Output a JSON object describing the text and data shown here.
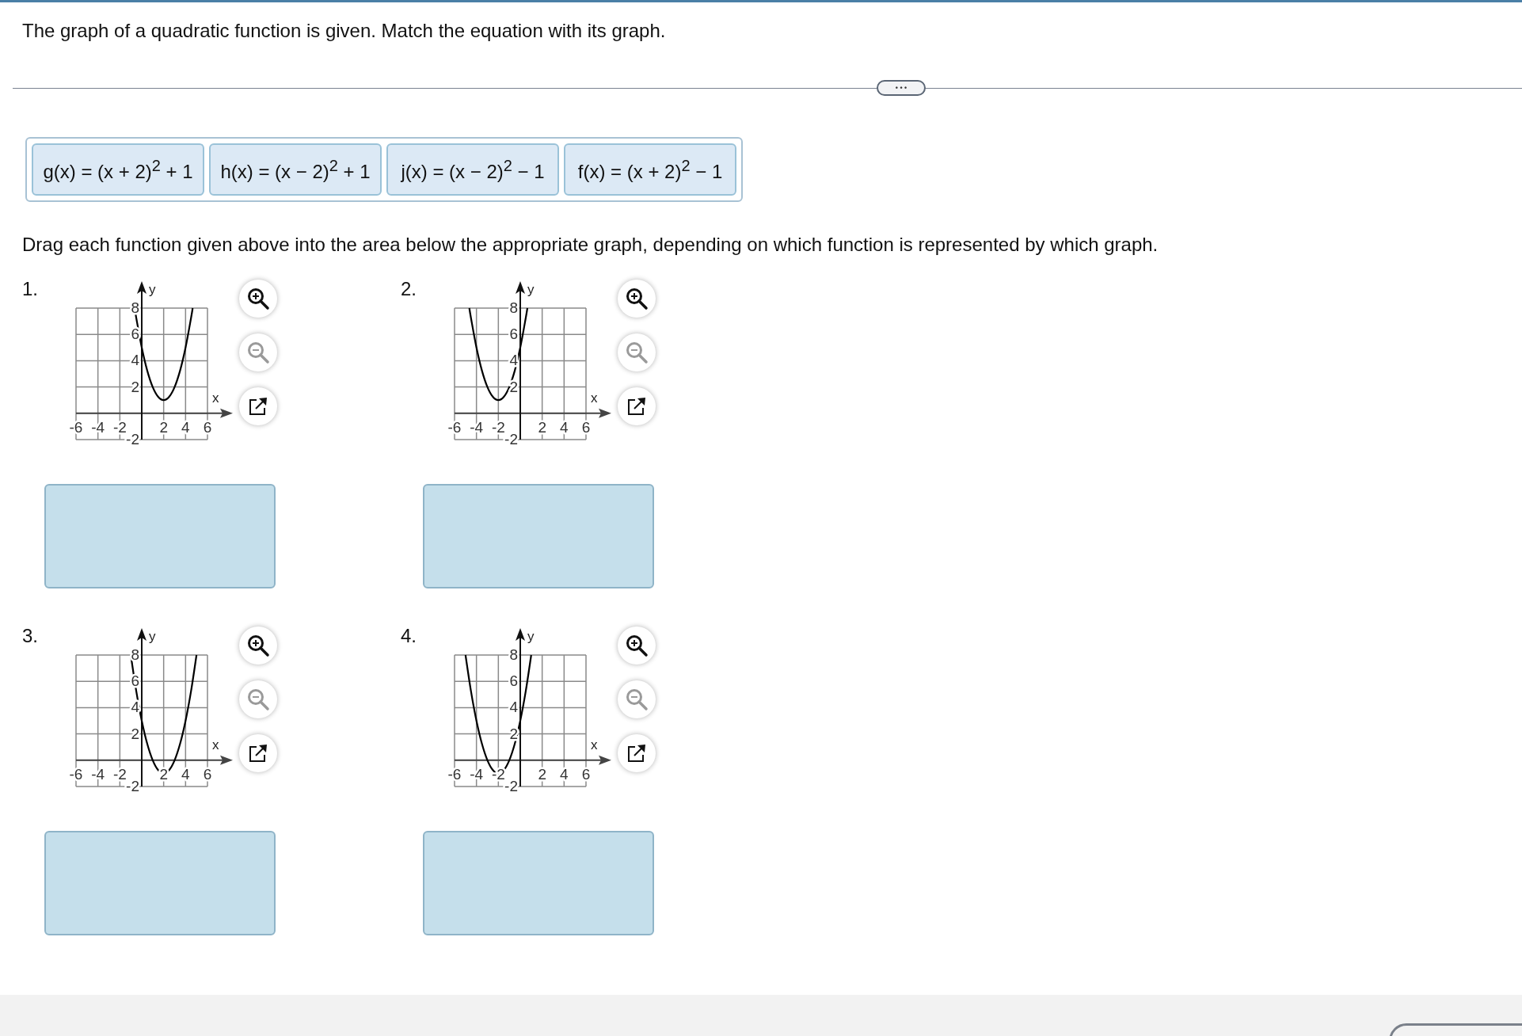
{
  "question": "The graph of a quadratic function is given. Match the equation with its graph.",
  "divider_button": "• • •",
  "choices": [
    "g(x) = (x + 2)$^{2}$ + 1",
    "h(x) = (x − 2)$^{2}$ + 1",
    "j(x) = (x − 2)$^{2}$ − 1",
    "f(x) = (x + 2)$^{2}$ − 1"
  ],
  "instruction": "Drag each function given above into the area below the appropriate graph, depending on which function is represented by which graph.",
  "graphs": [
    {
      "number": "1.",
      "zoom_out_disabled": true,
      "chart_data": {
        "type": "line",
        "xlabel": "x",
        "ylabel": "y",
        "xlim": [
          -6,
          6
        ],
        "ylim": [
          -2,
          8
        ],
        "xticks": [
          -6,
          -4,
          -2,
          2,
          4,
          6
        ],
        "yticks": [
          -2,
          2,
          4,
          6,
          8
        ],
        "x": [
          -0.65,
          -0.5,
          0,
          0.5,
          1,
          1.5,
          2,
          2.5,
          3,
          3.5,
          4,
          4.5,
          4.65
        ],
        "grid": true,
        "series": [
          {
            "color": "#000000",
            "values": [
              8,
              7.25,
              5,
              3.25,
              2,
              1.25,
              1,
              1.25,
              2,
              3.25,
              5,
              7.25,
              8
            ]
          }
        ]
      }
    },
    {
      "number": "2.",
      "zoom_out_disabled": true,
      "chart_data": {
        "type": "line",
        "xlabel": "x",
        "ylabel": "y",
        "xlim": [
          -6,
          6
        ],
        "ylim": [
          -2,
          8
        ],
        "xticks": [
          -6,
          -4,
          -2,
          2,
          4,
          6
        ],
        "yticks": [
          -2,
          2,
          4,
          6,
          8
        ],
        "x": [
          -4.65,
          -4.5,
          -4,
          -3.5,
          -3,
          -2.5,
          -2,
          -1.5,
          -1,
          -0.5,
          0,
          0.5,
          0.65
        ],
        "grid": true,
        "series": [
          {
            "color": "#000000",
            "values": [
              8,
              7.25,
              5,
              3.25,
              2,
              1.25,
              1,
              1.25,
              2,
              3.25,
              5,
              7.25,
              8
            ]
          }
        ]
      }
    },
    {
      "number": "3.",
      "zoom_out_disabled": true,
      "chart_data": {
        "type": "line",
        "xlabel": "x",
        "ylabel": "y",
        "xlim": [
          -6,
          6
        ],
        "ylim": [
          -2,
          8
        ],
        "xticks": [
          -6,
          -4,
          -2,
          2,
          4,
          6
        ],
        "yticks": [
          -2,
          2,
          4,
          6,
          8
        ],
        "x": [
          -1,
          -0.5,
          0,
          0.5,
          1,
          1.5,
          2,
          2.5,
          3,
          3.5,
          4,
          4.5,
          5
        ],
        "grid": true,
        "series": [
          {
            "color": "#000000",
            "values": [
              8,
              5.25,
              3,
              1.25,
              0,
              -0.75,
              -1,
              -0.75,
              0,
              1.25,
              3,
              5.25,
              8
            ]
          }
        ]
      }
    },
    {
      "number": "4.",
      "zoom_out_disabled": true,
      "chart_data": {
        "type": "line",
        "xlabel": "x",
        "ylabel": "y",
        "xlim": [
          -6,
          6
        ],
        "ylim": [
          -2,
          8
        ],
        "xticks": [
          -6,
          -4,
          -2,
          2,
          4,
          6
        ],
        "yticks": [
          -2,
          2,
          4,
          6,
          8
        ],
        "x": [
          -5,
          -4.5,
          -4,
          -3.5,
          -3,
          -2.5,
          -2,
          -1.5,
          -1,
          -0.5,
          0,
          0.5,
          1
        ],
        "grid": true,
        "series": [
          {
            "color": "#000000",
            "values": [
              8,
              5.25,
              3,
              1.25,
              0,
              -0.75,
              -1,
              -0.75,
              0,
              1.25,
              3,
              5.25,
              8
            ]
          }
        ]
      }
    }
  ]
}
